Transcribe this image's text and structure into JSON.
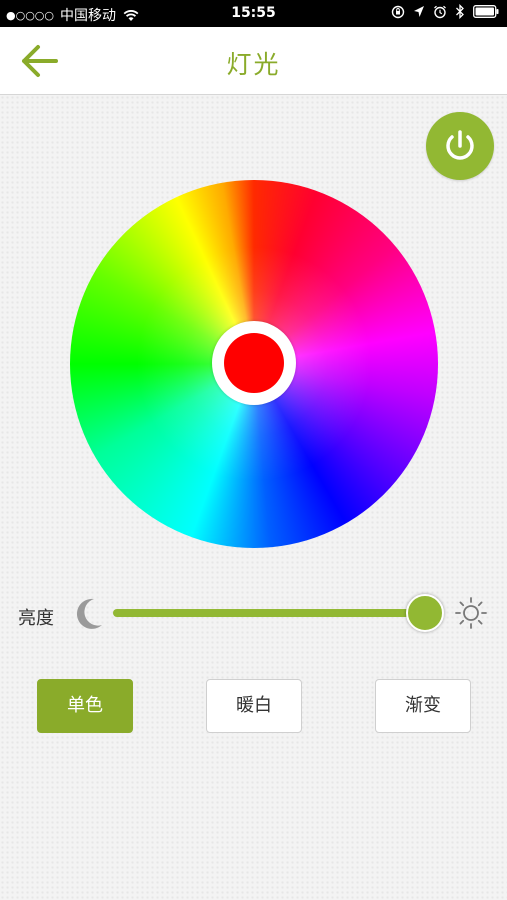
{
  "status_bar": {
    "carrier": "中国移动",
    "signal": "●○○○○",
    "time": "15:55"
  },
  "header": {
    "title": "灯光",
    "back_icon": "arrow-left-icon"
  },
  "power": {
    "icon": "power-icon",
    "color": "#92b833"
  },
  "color_wheel": {
    "selected_color": "#ff0000"
  },
  "brightness": {
    "label": "亮度",
    "level_percent": 100,
    "min_icon": "moon-icon",
    "max_icon": "sun-icon"
  },
  "modes": {
    "items": [
      "单色",
      "暖白",
      "渐变"
    ],
    "active": "单色"
  },
  "colors": {
    "accent": "#8aab2a"
  }
}
